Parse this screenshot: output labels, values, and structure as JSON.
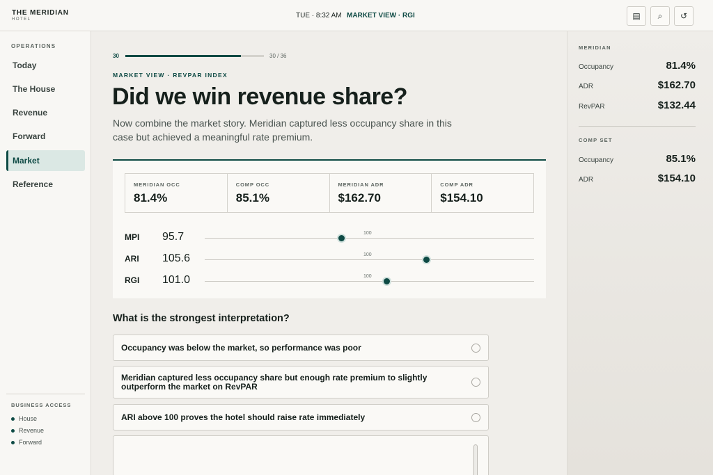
{
  "header": {
    "brand": "THE MERIDIAN",
    "brand_sub": "HOTEL",
    "time": "TUE · 8:32 AM",
    "view": "MARKET VIEW · RGI",
    "buttons": [
      {
        "icon": "document-icon",
        "glyph": "▤"
      },
      {
        "icon": "search-icon",
        "glyph": "⌕"
      },
      {
        "icon": "refresh-icon",
        "glyph": "↺"
      }
    ]
  },
  "sidebar": {
    "heading": "OPERATIONS",
    "items": [
      {
        "label": "Today",
        "active": false
      },
      {
        "label": "The House",
        "active": false
      },
      {
        "label": "Revenue",
        "active": false
      },
      {
        "label": "Forward",
        "active": false
      },
      {
        "label": "Market",
        "active": true
      },
      {
        "label": "Reference",
        "active": false
      }
    ],
    "access_heading": "BUSINESS ACCESS",
    "access_items": [
      "House",
      "Revenue",
      "Forward"
    ]
  },
  "main": {
    "progress": {
      "current_label": "30",
      "count_label": "30 / 36",
      "fraction": 0.833
    },
    "eyebrow": "MARKET VIEW · REVPAR INDEX",
    "title": "Did we win revenue share?",
    "intro": "Now combine the market story. Meridian captured less occupancy share in this case but achieved a meaningful rate premium.",
    "metrics": [
      {
        "label": "MERIDIAN OCC",
        "value": "81.4%"
      },
      {
        "label": "COMP OCC",
        "value": "85.1%"
      },
      {
        "label": "MERIDIAN ADR",
        "value": "$162.70"
      },
      {
        "label": "COMP ADR",
        "value": "$154.10"
      }
    ],
    "index_reference": "100",
    "indexes": [
      {
        "label": "MPI",
        "value": "95.7",
        "numeric": 95.7
      },
      {
        "label": "ARI",
        "value": "105.6",
        "numeric": 105.6
      },
      {
        "label": "RGI",
        "value": "101.0",
        "numeric": 101.0
      }
    ],
    "question": "What is the strongest interpretation?",
    "options": [
      {
        "text": "Occupancy was below the market, so performance was poor"
      },
      {
        "text": "Meridian captured less occupancy share but enough rate premium to slightly outperform the market on RevPAR"
      },
      {
        "text": "ARI above 100 proves the hotel should raise rate immediately"
      }
    ]
  },
  "right_panel": {
    "meridian_heading": "MERIDIAN",
    "meridian": [
      {
        "label": "Occupancy",
        "value": "81.4%"
      },
      {
        "label": "ADR",
        "value": "$162.70"
      },
      {
        "label": "RevPAR",
        "value": "$132.44"
      }
    ],
    "comp_heading": "COMP SET",
    "comp": [
      {
        "label": "Occupancy",
        "value": "85.1%"
      },
      {
        "label": "ADR",
        "value": "$154.10"
      }
    ]
  },
  "colors": {
    "accent": "#0e4a44",
    "active_bg": "#dbe8e4"
  }
}
